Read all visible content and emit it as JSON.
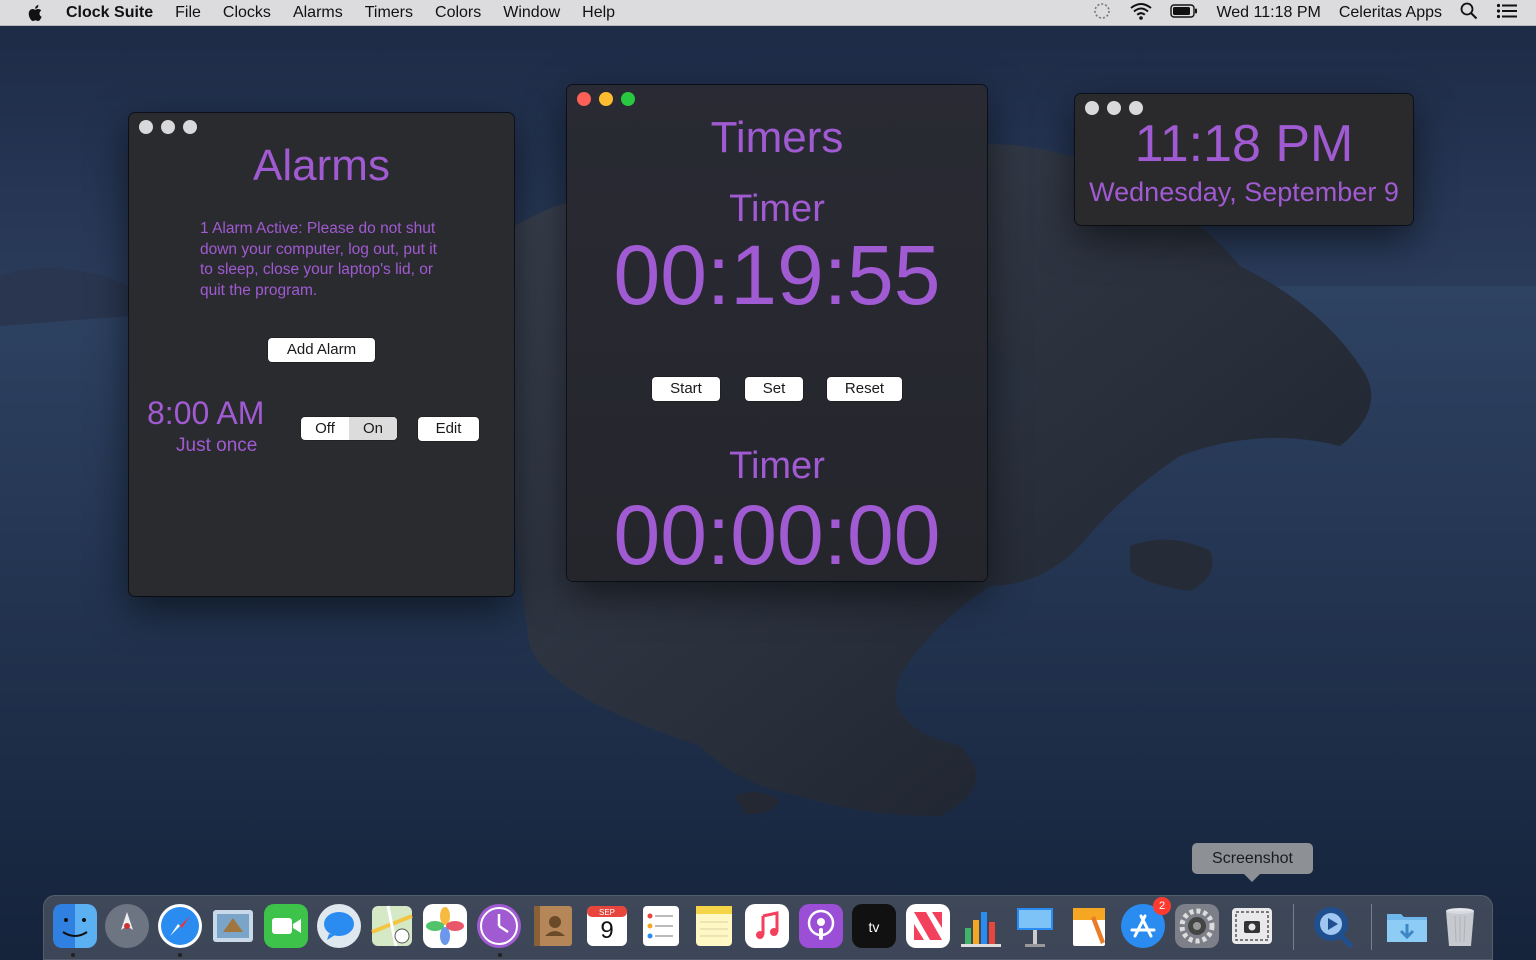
{
  "menubar": {
    "app_name": "Clock Suite",
    "menus": [
      "File",
      "Clocks",
      "Alarms",
      "Timers",
      "Colors",
      "Window",
      "Help"
    ],
    "datetime": "Wed 11:18 PM",
    "account": "Celeritas Apps"
  },
  "colors": {
    "accent": "#a05ad2",
    "window_bg": "#2a2b2e"
  },
  "alarms_window": {
    "title": "Alarms",
    "notice": "1 Alarm Active: Please do not shut down your computer, log out, put it to sleep, close your laptop's lid, or quit the program.",
    "add_button": "Add Alarm",
    "alarm": {
      "time": "8:00 AM",
      "repeat": "Just once",
      "toggle_off": "Off",
      "toggle_on": "On",
      "selected": "On",
      "edit_button": "Edit"
    }
  },
  "timers_window": {
    "title": "Timers",
    "timer1": {
      "label": "Timer",
      "value": "00:19:55"
    },
    "timer2": {
      "label": "Timer",
      "value": "00:00:00"
    },
    "start_button": "Start",
    "set_button": "Set",
    "reset_button": "Reset"
  },
  "clock_window": {
    "time": "11:18 PM",
    "date": "Wednesday, September 9"
  },
  "dock": {
    "tooltip": "Screenshot",
    "calendar_month": "SEP",
    "calendar_day": "9",
    "appstore_badge": "2",
    "apps": [
      "finder-icon",
      "launchpad-icon",
      "safari-icon",
      "mail-icon",
      "facetime-icon",
      "messages-icon",
      "maps-icon",
      "photos-icon",
      "clock-suite-icon",
      "contacts-icon",
      "calendar-icon",
      "reminders-icon",
      "notes-icon",
      "music-icon",
      "podcasts-icon",
      "tv-icon",
      "news-icon",
      "numbers-icon",
      "keynote-icon",
      "pages-icon",
      "app-store-icon",
      "system-preferences-icon",
      "screenshot-icon",
      "quicktime-icon",
      "downloads-icon",
      "trash-icon"
    ]
  }
}
